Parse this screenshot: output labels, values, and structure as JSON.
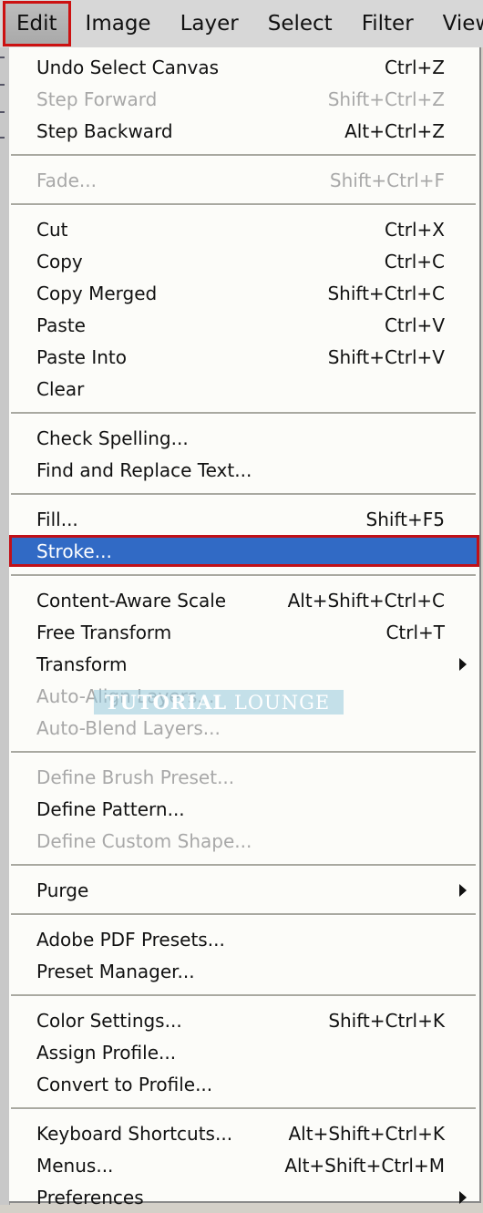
{
  "menubar": {
    "items": [
      {
        "label": "Edit",
        "active": true
      },
      {
        "label": "Image"
      },
      {
        "label": "Layer"
      },
      {
        "label": "Select"
      },
      {
        "label": "Filter"
      },
      {
        "label": "View"
      }
    ]
  },
  "menu": {
    "groups": [
      [
        {
          "label": "Undo Select Canvas",
          "shortcut": "Ctrl+Z"
        },
        {
          "label": "Step Forward",
          "shortcut": "Shift+Ctrl+Z",
          "disabled": true
        },
        {
          "label": "Step Backward",
          "shortcut": "Alt+Ctrl+Z"
        }
      ],
      [
        {
          "label": "Fade...",
          "shortcut": "Shift+Ctrl+F",
          "disabled": true
        }
      ],
      [
        {
          "label": "Cut",
          "shortcut": "Ctrl+X"
        },
        {
          "label": "Copy",
          "shortcut": "Ctrl+C"
        },
        {
          "label": "Copy Merged",
          "shortcut": "Shift+Ctrl+C"
        },
        {
          "label": "Paste",
          "shortcut": "Ctrl+V"
        },
        {
          "label": "Paste Into",
          "shortcut": "Shift+Ctrl+V"
        },
        {
          "label": "Clear",
          "shortcut": ""
        }
      ],
      [
        {
          "label": "Check Spelling...",
          "shortcut": ""
        },
        {
          "label": "Find and Replace Text...",
          "shortcut": ""
        }
      ],
      [
        {
          "label": "Fill...",
          "shortcut": "Shift+F5"
        },
        {
          "label": "Stroke...",
          "shortcut": "",
          "highlighted": true
        }
      ],
      [
        {
          "label": "Content-Aware Scale",
          "shortcut": "Alt+Shift+Ctrl+C"
        },
        {
          "label": "Free Transform",
          "shortcut": "Ctrl+T"
        },
        {
          "label": "Transform",
          "shortcut": "",
          "submenu": true
        },
        {
          "label": "Auto-Align Layers...",
          "shortcut": "",
          "disabled": true
        },
        {
          "label": "Auto-Blend Layers...",
          "shortcut": "",
          "disabled": true
        }
      ],
      [
        {
          "label": "Define Brush Preset...",
          "shortcut": "",
          "disabled": true
        },
        {
          "label": "Define Pattern...",
          "shortcut": ""
        },
        {
          "label": "Define Custom Shape...",
          "shortcut": "",
          "disabled": true
        }
      ],
      [
        {
          "label": "Purge",
          "shortcut": "",
          "submenu": true
        }
      ],
      [
        {
          "label": "Adobe PDF Presets...",
          "shortcut": ""
        },
        {
          "label": "Preset Manager...",
          "shortcut": ""
        }
      ],
      [
        {
          "label": "Color Settings...",
          "shortcut": "Shift+Ctrl+K"
        },
        {
          "label": "Assign Profile...",
          "shortcut": ""
        },
        {
          "label": "Convert to Profile...",
          "shortcut": ""
        }
      ],
      [
        {
          "label": "Keyboard Shortcuts...",
          "shortcut": "Alt+Shift+Ctrl+K"
        },
        {
          "label": "Menus...",
          "shortcut": "Alt+Shift+Ctrl+M"
        },
        {
          "label": "Preferences",
          "shortcut": "",
          "submenu": true
        }
      ]
    ]
  },
  "watermark": {
    "bold": "TUTORIAL",
    "light": "LOUNGE"
  },
  "colors": {
    "highlight": "#316ac5",
    "annotation_red": "#c01018"
  }
}
